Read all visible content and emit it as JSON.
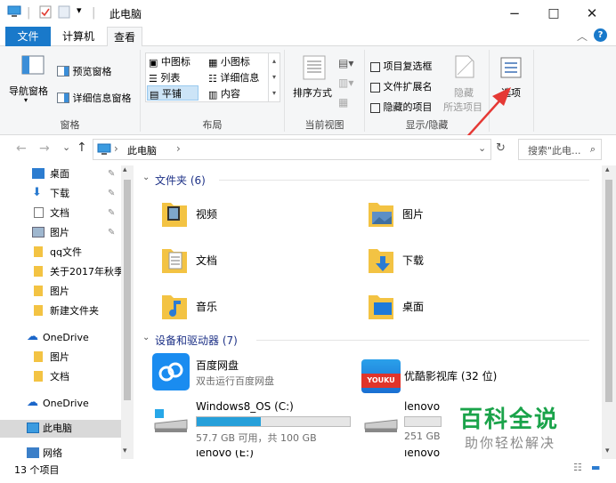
{
  "titlebar": {
    "title": "此电脑",
    "minimize": "−",
    "maximize": "□",
    "close": "✕"
  },
  "tabs": {
    "file": "文件",
    "computer": "计算机",
    "view": "查看"
  },
  "ribbon": {
    "nav_pane": "导航窗格",
    "preview_pane": "预览窗格",
    "details_pane": "详细信息窗格",
    "pane_group": "窗格",
    "medium_icons": "中图标",
    "small_icons": "小图标",
    "list": "列表",
    "details": "详细信息",
    "tiles": "平铺",
    "content": "内容",
    "layout_group": "布局",
    "sort_by": "排序方式",
    "current_view_group": "当前视图",
    "item_checkboxes": "项目复选框",
    "file_extensions": "文件扩展名",
    "hidden_items": "隐藏的项目",
    "hide": "隐藏",
    "hide_selected": "所选项目",
    "show_hide_group": "显示/隐藏",
    "options": "选项"
  },
  "address": {
    "path": "此电脑",
    "search_placeholder": "搜索\"此电...",
    "back": "←",
    "forward": "→",
    "dropdown": "⌄",
    "up": "↑",
    "refresh": "↻",
    "chevron": "›"
  },
  "nav": {
    "items": [
      {
        "label": "桌面",
        "pinned": true
      },
      {
        "label": "下载",
        "pinned": true
      },
      {
        "label": "文档",
        "pinned": true
      },
      {
        "label": "图片",
        "pinned": true
      },
      {
        "label": "qq文件",
        "pinned": false
      },
      {
        "label": "关于2017年秋季",
        "pinned": false
      },
      {
        "label": "图片",
        "pinned": false
      },
      {
        "label": "新建文件夹",
        "pinned": false
      },
      {
        "label": "OneDrive",
        "pinned": false
      },
      {
        "label": "图片",
        "pinned": false
      },
      {
        "label": "文档",
        "pinned": false
      },
      {
        "label": "OneDrive",
        "pinned": false
      },
      {
        "label": "此电脑",
        "pinned": false
      },
      {
        "label": "网络",
        "pinned": false
      }
    ]
  },
  "folders": {
    "header": "文件夹 (6)",
    "items": [
      "视频",
      "图片",
      "文档",
      "下载",
      "音乐",
      "桌面"
    ]
  },
  "devices": {
    "header": "设备和驱动器 (7)",
    "baidu": {
      "name": "百度网盘",
      "desc": "双击运行百度网盘"
    },
    "youku": {
      "name": "优酷影视库 (32 位)",
      "logo": "YOUKU"
    },
    "drive_c": {
      "name": "Windows8_OS (C:)",
      "info": "57.7 GB 可用，共 100 GB",
      "used": 0.42
    },
    "drive_lenovo": {
      "name": "lenovo",
      "info": "251 GB"
    },
    "drive_e": {
      "name": "lenovo (E:)"
    },
    "drive_f": {
      "name": "lenovo"
    }
  },
  "status": {
    "count": "13 个项目"
  },
  "watermark": {
    "title": "百科全说",
    "subtitle": "助你轻松解决"
  },
  "colors": {
    "accent": "#1979ca",
    "folder": "#f3c343",
    "arrow": "#e53935",
    "drive_fill": "#26a0da"
  }
}
